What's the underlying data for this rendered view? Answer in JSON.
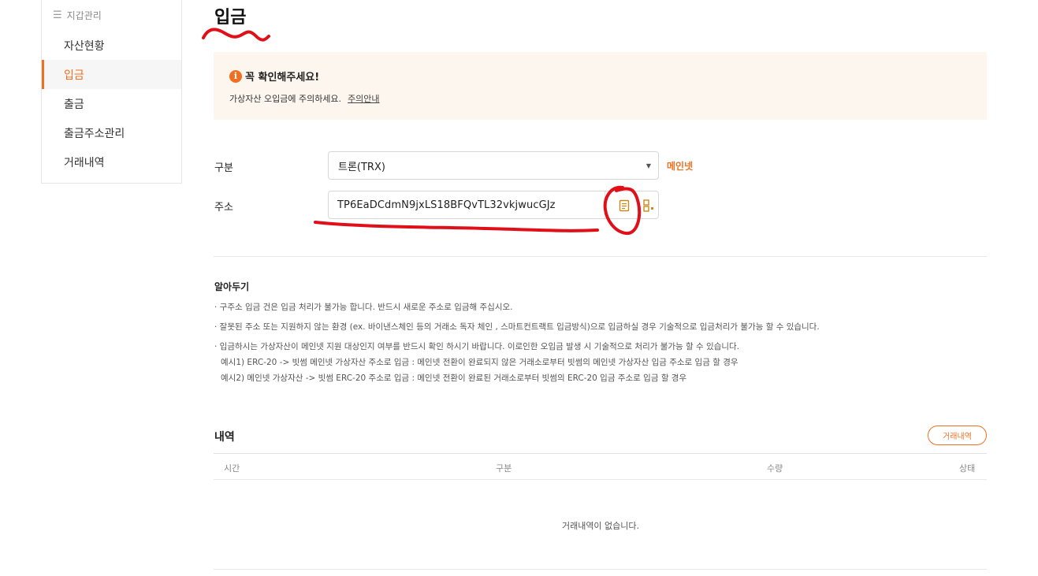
{
  "sidebar": {
    "header": "지갑관리",
    "items": [
      {
        "label": "자산현황",
        "active": false
      },
      {
        "label": "입금",
        "active": true
      },
      {
        "label": "출금",
        "active": false
      },
      {
        "label": "출금주소관리",
        "active": false
      },
      {
        "label": "거래내역",
        "active": false
      }
    ]
  },
  "page": {
    "title": "입금"
  },
  "notice": {
    "title": "꼭 확인해주세요!",
    "text": "가상자산 오입금에 주의하세요.",
    "link": "주의안내"
  },
  "form": {
    "type_label": "구분",
    "type_value": "트론(TRX)",
    "network": "메인넷",
    "address_label": "주소",
    "address_value": "TP6EaDCdmN9jxLS18BFQvTL32vkjwucGJz"
  },
  "notes": {
    "title": "알아두기",
    "lines": [
      "· 구주소 입금 건은 입금 처리가 불가능 합니다. 반드시 새로운 주소로 입금해 주십시오.",
      "· 잘못된 주소 또는 지원하지 않는 환경 (ex. 바이낸스체인 등의 거래소 독자 체인 , 스마트컨트랙트 입금방식)으로 입금하실 경우 기술적으로 입금처리가 불가능 할 수 있습니다.",
      "· 입금하시는 가상자산이 메인넷 지원 대상인지 여부를 반드시 확인 하시기 바랍니다. 이로인한 오입금 발생 시 기술적으로 처리가 불가능 할 수 있습니다.",
      "예시1) ERC-20 -> 빗썸 메인넷 가상자산 주소로 입금 : 메인넷 전환이 완료되지 않은 거래소로부터 빗썸의 메인넷 가상자산 입금 주소로 입금 할 경우",
      "예시2) 메인넷 가상자산 -> 빗썸 ERC-20 주소로 입금 : 메인넷 전환이 완료된 거래소로부터 빗썸의 ERC-20 입금 주소로 입금 할 경우"
    ]
  },
  "history": {
    "title": "내역",
    "button": "거래내역",
    "columns": [
      "시간",
      "구분",
      "수량",
      "상태"
    ],
    "empty": "거래내역이 없습니다."
  },
  "colors": {
    "accent": "#ef7023",
    "annotation": "#e0101a",
    "notice_bg": "#fdf6ee"
  },
  "icons": {
    "info": "info-icon",
    "copy": "copy-icon",
    "qr": "qr-code-icon",
    "menu": "menu-icon",
    "caret": "chevron-down-icon"
  }
}
